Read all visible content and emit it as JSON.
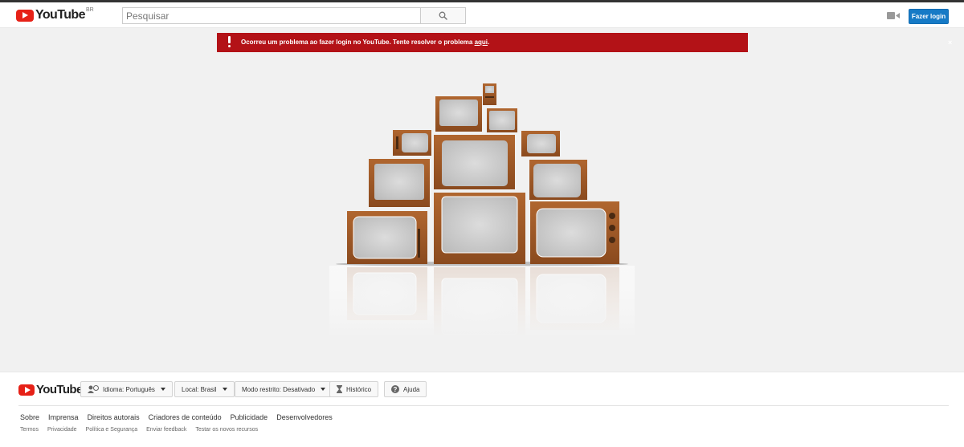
{
  "header": {
    "logo_text": "YouTube",
    "country_code": "BR",
    "search_placeholder": "Pesquisar",
    "search_icon": "search-icon",
    "upload_icon": "video-camera-icon",
    "signin_label": "Fazer login"
  },
  "error_banner": {
    "icon": "exclamation-icon",
    "message": "Ocorreu um problema ao fazer login no YouTube. Tente resolver o problema ",
    "link_text": "aqui",
    "suffix": ".",
    "close_label": "×",
    "color": "#b31217"
  },
  "illustration": {
    "icon": "stacked-televisions-illustration"
  },
  "footer": {
    "logo_text": "YouTube",
    "language_label": "Idioma: Português",
    "location_label": "Local: Brasil",
    "restricted_label": "Modo restrito: Desativado",
    "history_label": "Histórico",
    "help_label": "Ajuda",
    "primary_links": [
      "Sobre",
      "Imprensa",
      "Direitos autorais",
      "Criadores de conteúdo",
      "Publicidade",
      "Desenvolvedores"
    ],
    "secondary_links": [
      "Termos",
      "Privacidade",
      "Política e Segurança",
      "Enviar feedback",
      "Testar os novos recursos"
    ]
  },
  "colors": {
    "brand_red": "#e62117",
    "signin_blue": "#167ac6",
    "background": "#f1f1f1"
  }
}
